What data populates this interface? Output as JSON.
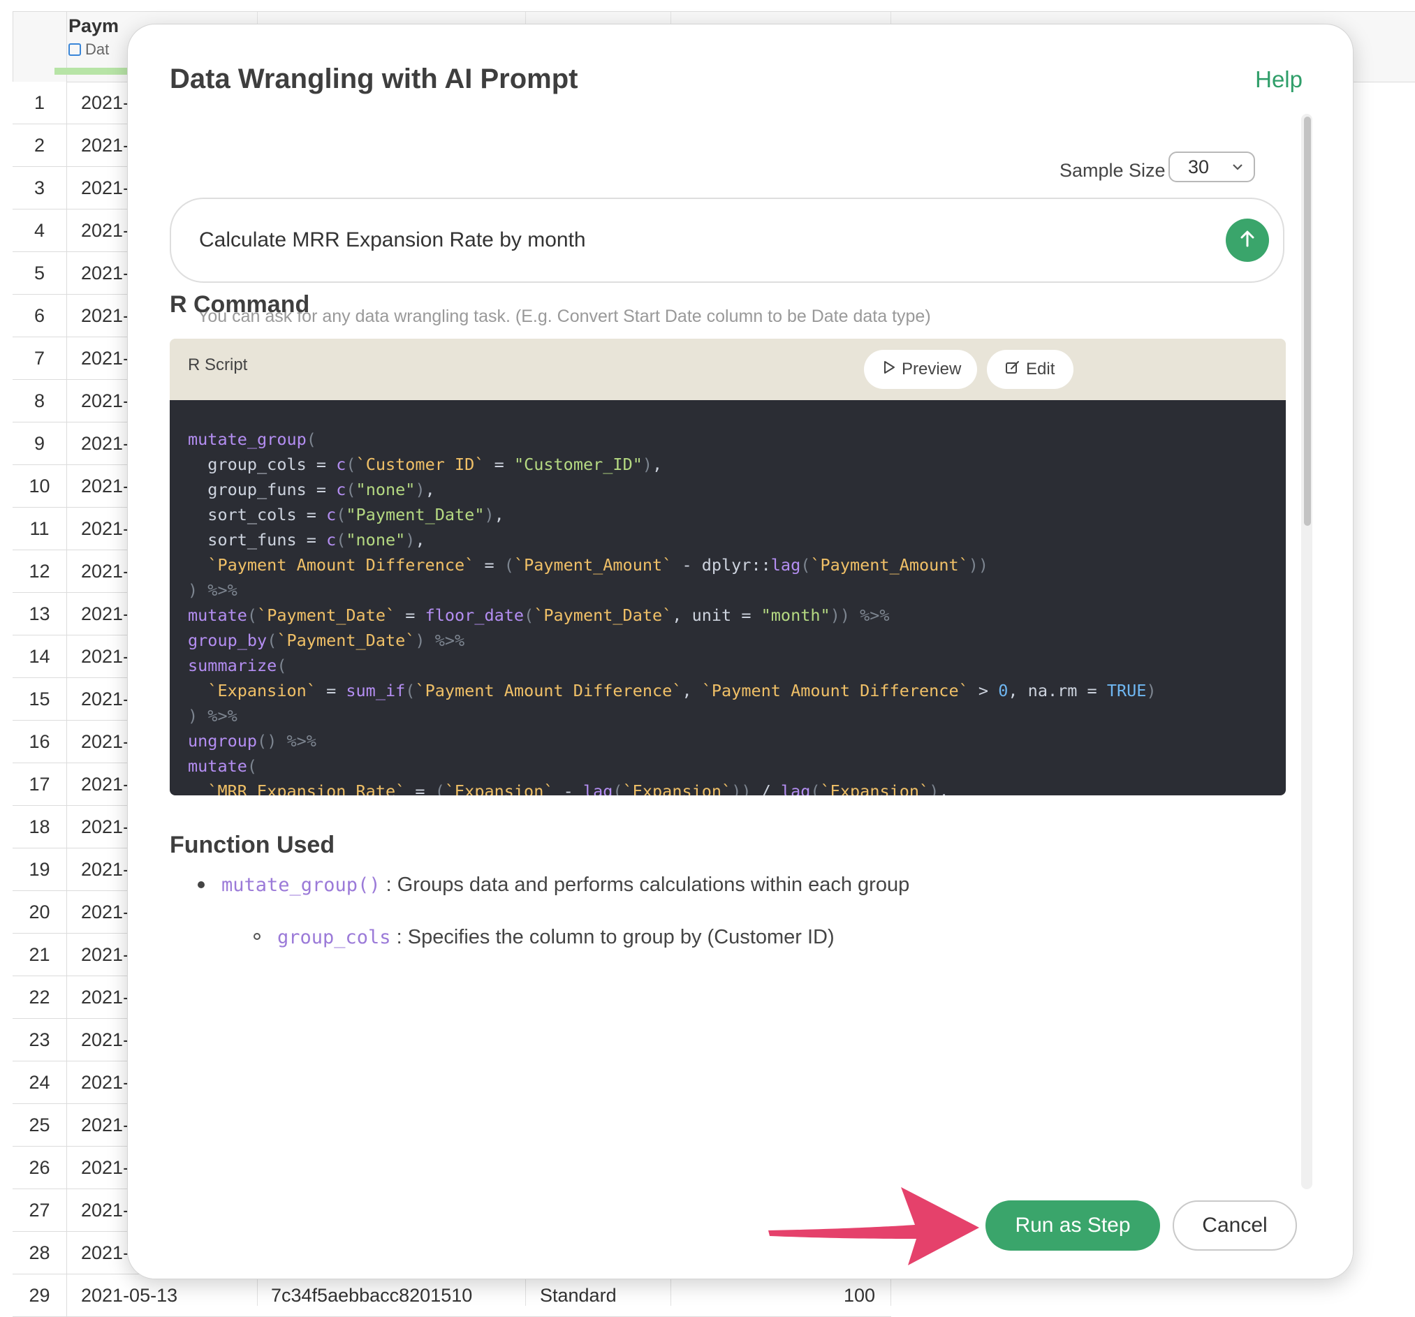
{
  "background": {
    "column_title": "Paym",
    "column_type": "Dat",
    "rows": [
      {
        "n": "1",
        "v": "2021-"
      },
      {
        "n": "2",
        "v": "2021-"
      },
      {
        "n": "3",
        "v": "2021-"
      },
      {
        "n": "4",
        "v": "2021-"
      },
      {
        "n": "5",
        "v": "2021-"
      },
      {
        "n": "6",
        "v": "2021-"
      },
      {
        "n": "7",
        "v": "2021-"
      },
      {
        "n": "8",
        "v": "2021-"
      },
      {
        "n": "9",
        "v": "2021-"
      },
      {
        "n": "10",
        "v": "2021-"
      },
      {
        "n": "11",
        "v": "2021-"
      },
      {
        "n": "12",
        "v": "2021-"
      },
      {
        "n": "13",
        "v": "2021-"
      },
      {
        "n": "14",
        "v": "2021-"
      },
      {
        "n": "15",
        "v": "2021-"
      },
      {
        "n": "16",
        "v": "2021-"
      },
      {
        "n": "17",
        "v": "2021-"
      },
      {
        "n": "18",
        "v": "2021-"
      },
      {
        "n": "19",
        "v": "2021-"
      },
      {
        "n": "20",
        "v": "2021-"
      },
      {
        "n": "21",
        "v": "2021-"
      },
      {
        "n": "22",
        "v": "2021-"
      },
      {
        "n": "23",
        "v": "2021-"
      },
      {
        "n": "24",
        "v": "2021-"
      },
      {
        "n": "25",
        "v": "2021-"
      },
      {
        "n": "26",
        "v": "2021-"
      },
      {
        "n": "27",
        "v": "2021-"
      },
      {
        "n": "28",
        "v": "2021-"
      },
      {
        "n": "29",
        "v": "2021-05-13",
        "t1": "7c34f5aebbacc8201510",
        "t2": "Standard",
        "t3": "100"
      }
    ]
  },
  "modal": {
    "title": "Data Wrangling with AI Prompt",
    "help": "Help",
    "sample_size_label": "Sample Size",
    "sample_size_value": "30",
    "prompt_value": "Calculate MRR Expansion Rate by month",
    "hint": "You can ask for any data wrangling task. (E.g. Convert Start Date column to be Date data type)",
    "r_command_title": "R Command",
    "script_label": "R Script",
    "preview_label": "Preview",
    "edit_label": "Edit",
    "function_used_title": "Function Used",
    "functions": [
      {
        "name": "mutate_group()",
        "desc": " : Groups data and performs calculations within each group"
      }
    ],
    "sub_items": [
      {
        "name": "group_cols",
        "desc": " : Specifies the column to group by (Customer ID)"
      }
    ],
    "run_label": "Run as Step",
    "cancel_label": "Cancel"
  },
  "colors": {
    "accent_green": "#3aa56b",
    "help_green": "#2f9e69",
    "code_bg": "#2b2d34",
    "script_header_bg": "#e8e4d8",
    "annotation_arrow": "#e5416b"
  },
  "icons": {
    "send": "arrow-up-icon",
    "preview": "play-outline-icon",
    "edit": "edit-icon",
    "select": "chevron-down-icon",
    "column_type": "calendar-icon"
  }
}
